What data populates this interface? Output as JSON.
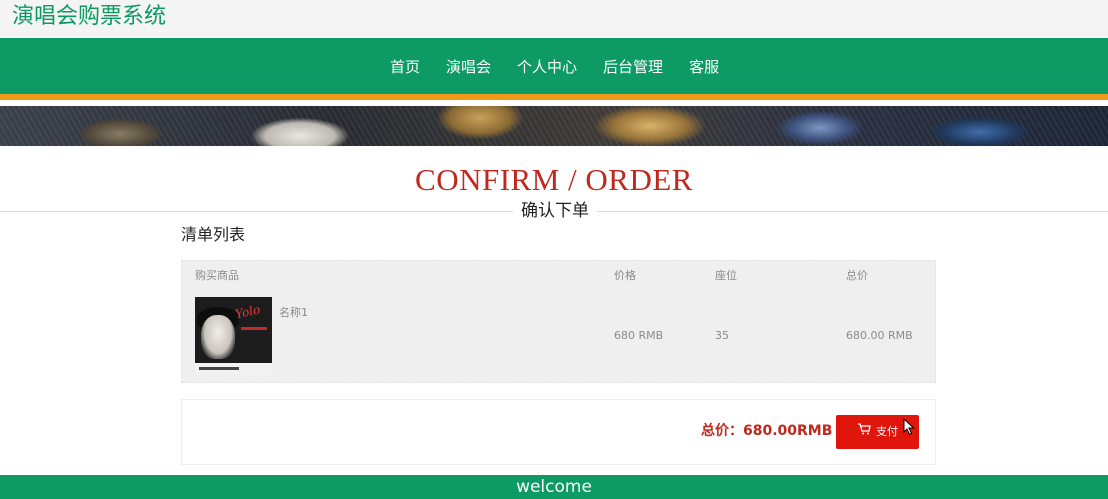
{
  "site": {
    "title": "演唱会购票系统"
  },
  "nav": {
    "items": [
      "首页",
      "演唱会",
      "个人中心",
      "后台管理",
      "客服"
    ]
  },
  "heading": {
    "english": "CONFIRM / ORDER",
    "chinese": "确认下单"
  },
  "order_list": {
    "title": "清单列表",
    "columns": {
      "product": "购买商品",
      "price": "价格",
      "seat": "座位",
      "total": "总价"
    },
    "rows": [
      {
        "name": "名称1",
        "price": "680 RMB",
        "seat": "35",
        "total": "680.00 RMB",
        "thumbnail_icon": "concert-poster-thumbnail"
      }
    ]
  },
  "summary": {
    "total_label": "总价：680.00RMB",
    "pay_button": "支付"
  },
  "footer": {
    "text": "welcome"
  },
  "colors": {
    "brand_green": "#0e9a64",
    "accent_orange": "#f29a1a",
    "accent_red": "#c0281e",
    "button_red": "#e0150c"
  }
}
